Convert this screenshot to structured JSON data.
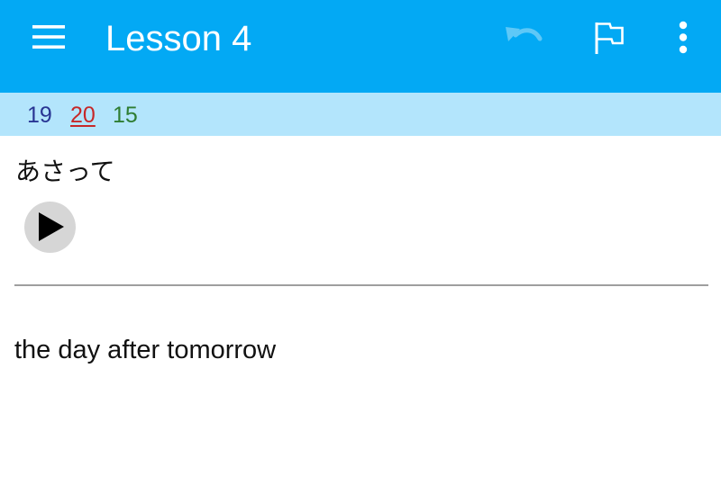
{
  "toolbar": {
    "title": "Lesson 4",
    "background_color": "#03a9f4",
    "icons": {
      "menu": "hamburger-menu-icon",
      "undo": "undo-icon",
      "flag": "flag-icon",
      "more": "more-vertical-icon"
    }
  },
  "stats": {
    "known": "19",
    "current": "20",
    "learned": "15",
    "colors": {
      "known": "#283593",
      "current": "#c62828",
      "learned": "#2e7d32",
      "bar": "#b3e5fc"
    }
  },
  "card": {
    "term": "あさって",
    "play_icon": "play-icon",
    "meaning": "the day after tomorrow"
  }
}
